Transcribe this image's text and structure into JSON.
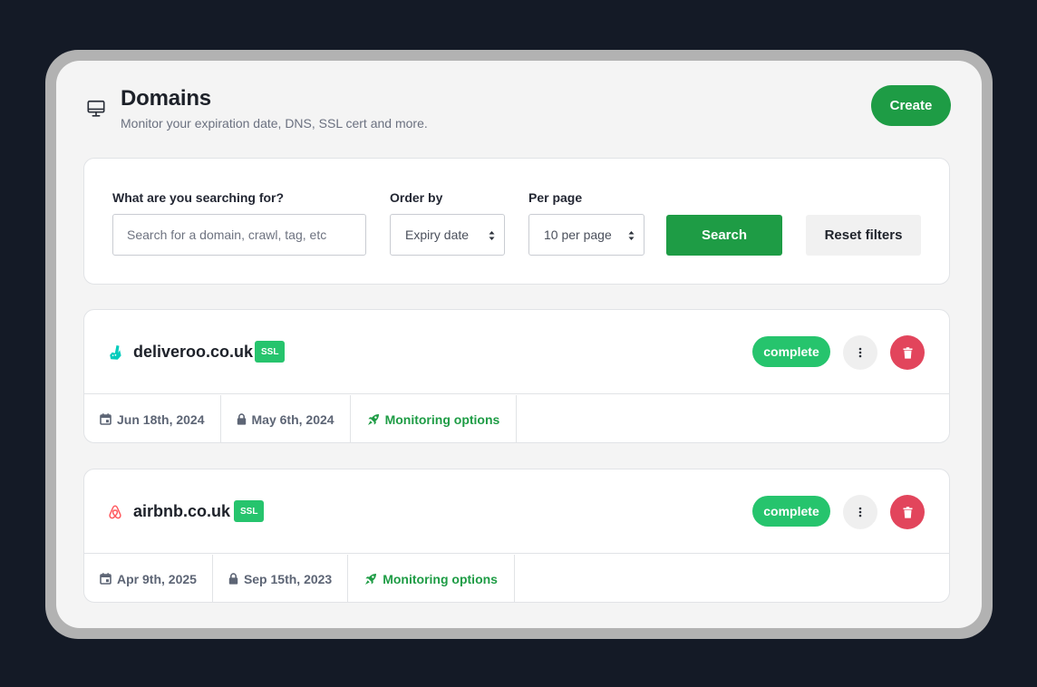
{
  "header": {
    "title": "Domains",
    "subtitle": "Monitor your expiration date, DNS, SSL cert and more.",
    "icon": "monitor-icon",
    "create_label": "Create"
  },
  "filters": {
    "search_label": "What are you searching for?",
    "search_placeholder": "Search for a domain, crawl, tag, etc",
    "search_value": "",
    "order_label": "Order by",
    "order_value": "Expiry date",
    "per_page_label": "Per page",
    "per_page_value": "10 per page",
    "search_button": "Search",
    "reset_button": "Reset filters"
  },
  "domains": [
    {
      "name": "deliveroo.co.uk",
      "logo": "deliveroo-logo-icon",
      "badge": "SSL",
      "status": "complete",
      "expiry_date": "Jun 18th, 2024",
      "ssl_date": "May 6th, 2024",
      "monitoring_label": "Monitoring options"
    },
    {
      "name": "airbnb.co.uk",
      "logo": "airbnb-logo-icon",
      "badge": "SSL",
      "status": "complete",
      "expiry_date": "Apr 9th, 2025",
      "ssl_date": "Sep 15th, 2023",
      "monitoring_label": "Monitoring options"
    }
  ],
  "colors": {
    "primary_green": "#1e9c45",
    "badge_green": "#26c46d",
    "danger_red": "#e2455c",
    "page_background": "#141a26"
  }
}
